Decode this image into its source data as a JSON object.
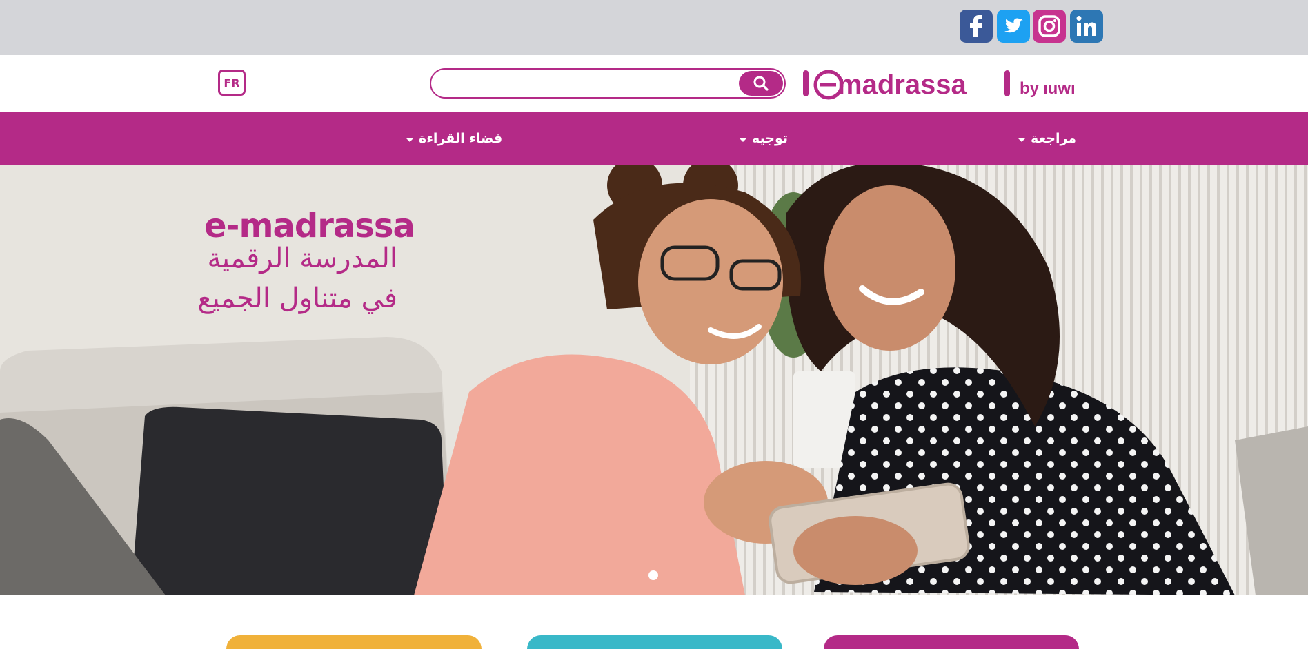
{
  "social": {
    "facebook_icon": "facebook-icon",
    "twitter_icon": "twitter-icon",
    "instagram_icon": "instagram-icon",
    "linkedin_icon": "linkedin-icon"
  },
  "header": {
    "lang_button": "FR",
    "search": {
      "placeholder": "",
      "value": ""
    },
    "logo_text": "emadrassa",
    "logo_suffix": "by inwi"
  },
  "nav": {
    "items": [
      {
        "label": "مراجعة"
      },
      {
        "label": "توجيه"
      },
      {
        "label": "فضاء القراءة"
      }
    ]
  },
  "hero": {
    "brand": "e-madrassa",
    "line1": "المدرسة الرقمية",
    "line2": "في متناول الجميع"
  },
  "colors": {
    "brand": "#b42a87",
    "topbar": "#d4d5d9",
    "card1": "#f0b13a",
    "card2": "#39b8c8",
    "card3": "#b42a87"
  }
}
